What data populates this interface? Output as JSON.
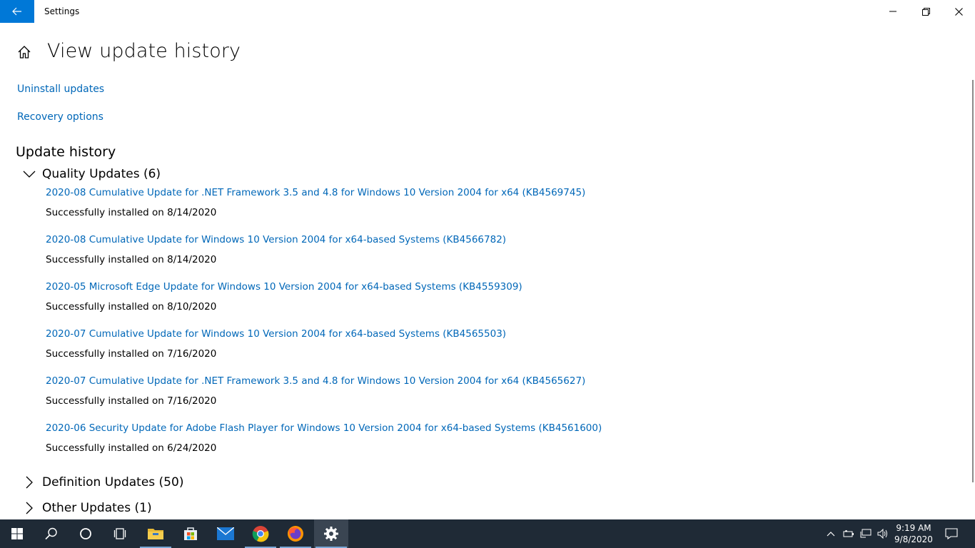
{
  "window": {
    "title": "Settings"
  },
  "page": {
    "title": "View update history"
  },
  "links": {
    "uninstall": "Uninstall updates",
    "recovery": "Recovery options"
  },
  "history": {
    "title": "Update history",
    "groups": [
      {
        "label": "Quality Updates (6)",
        "expanded": true
      },
      {
        "label": "Definition Updates (50)",
        "expanded": false
      },
      {
        "label": "Other Updates (1)",
        "expanded": false
      }
    ],
    "quality_updates": [
      {
        "name": "2020-08 Cumulative Update for .NET Framework 3.5 and 4.8 for Windows 10 Version 2004 for x64 (KB4569745)",
        "status": "Successfully installed on 8/14/2020"
      },
      {
        "name": "2020-08 Cumulative Update for Windows 10 Version 2004 for x64-based Systems (KB4566782)",
        "status": "Successfully installed on 8/14/2020"
      },
      {
        "name": "2020-05 Microsoft Edge Update for Windows 10 Version 2004 for x64-based Systems (KB4559309)",
        "status": "Successfully installed on 8/10/2020"
      },
      {
        "name": "2020-07 Cumulative Update for Windows 10 Version 2004 for x64-based Systems (KB4565503)",
        "status": "Successfully installed on 7/16/2020"
      },
      {
        "name": "2020-07 Cumulative Update for .NET Framework 3.5 and 4.8 for Windows 10 Version 2004 for x64 (KB4565627)",
        "status": "Successfully installed on 7/16/2020"
      },
      {
        "name": "2020-06 Security Update for Adobe Flash Player for Windows 10 Version 2004 for x64-based Systems (KB4561600)",
        "status": "Successfully installed on 6/24/2020"
      }
    ]
  },
  "taskbar": {
    "clock_time": "9:19 AM",
    "clock_date": "9/8/2020",
    "apps": [
      "start-icon",
      "search-icon",
      "cortana-icon",
      "task-view-icon",
      "file-explorer-icon",
      "store-icon",
      "mail-icon",
      "chrome-icon",
      "firefox-icon",
      "settings-icon"
    ],
    "active_app": "settings-icon"
  },
  "colors": {
    "accent": "#0078d7",
    "link": "#0067b8",
    "taskbar": "#1f2a36"
  }
}
